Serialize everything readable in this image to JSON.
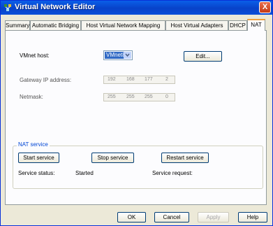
{
  "window": {
    "title": "Virtual Network Editor",
    "close_glyph": "X"
  },
  "tabs": [
    {
      "label": "Summary"
    },
    {
      "label": "Automatic Bridging"
    },
    {
      "label": "Host Virtual Network Mapping"
    },
    {
      "label": "Host Virtual Adapters"
    },
    {
      "label": "DHCP"
    },
    {
      "label": "NAT"
    }
  ],
  "active_tab": "NAT",
  "nat": {
    "vmnet_host_label": "VMnet host:",
    "vmnet_host_value": "VMnet8",
    "edit_button": "Edit...",
    "gateway_label": "Gateway IP address:",
    "gateway_octets": [
      "192",
      "168",
      "177",
      "2"
    ],
    "netmask_label": "Netmask:",
    "netmask_octets": [
      "255",
      "255",
      "255",
      "0"
    ]
  },
  "nat_service": {
    "group_title": "NAT service",
    "start_button": "Start service",
    "stop_button": "Stop service",
    "restart_button": "Restart service",
    "status_label": "Service status:",
    "status_value": "Started",
    "request_label": "Service request:"
  },
  "footer": {
    "ok": "OK",
    "cancel": "Cancel",
    "apply": "Apply",
    "help": "Help"
  },
  "colors": {
    "titlebar": "#0842c9",
    "active_tab_accent": "#f0a23e",
    "group_title": "#0046d5"
  }
}
